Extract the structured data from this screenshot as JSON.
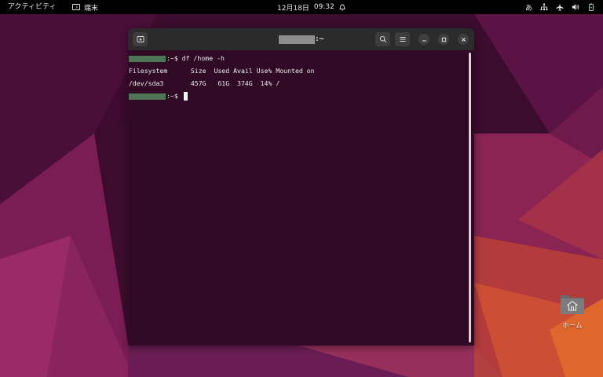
{
  "topbar": {
    "activities": "アクティビティ",
    "app_name": "端末",
    "app_icon": "terminal-icon",
    "date": "12月18日",
    "time": "09:32",
    "ime": "あ",
    "status_icons": [
      "network-icon",
      "airplane-mode-icon",
      "volume-icon",
      "battery-icon"
    ]
  },
  "terminal": {
    "title_suffix": ":~",
    "lines": [
      {
        "prompt": ":~$ ",
        "command": "df /home -h"
      },
      {
        "text": "Filesystem      Size  Used Avail Use% Mounted on"
      },
      {
        "text": "/dev/sda3       457G   61G  374G  14% /"
      },
      {
        "prompt": ":~$ ",
        "command": ""
      }
    ],
    "buttons": [
      "new-tab-icon",
      "search-icon",
      "menu-icon",
      "minimize-icon",
      "maximize-icon",
      "close-icon"
    ]
  },
  "desktop": {
    "home_label": "ホーム"
  },
  "colors": {
    "terminal_bg": "#300a24",
    "titlebar_bg": "#2b2b2b",
    "topbar_bg": "#000000",
    "redaction_user": "#4e7556",
    "redaction_title": "#8d8d8d"
  }
}
